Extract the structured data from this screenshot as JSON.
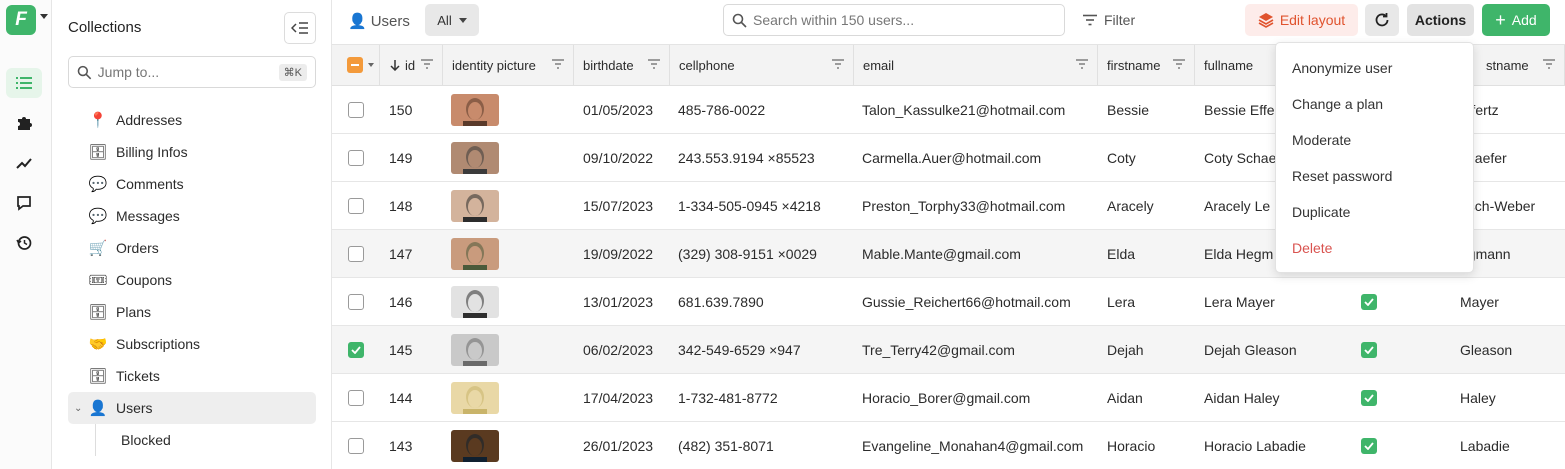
{
  "app": {
    "logo_letter": "F"
  },
  "sidebar": {
    "title": "Collections",
    "search_placeholder": "Jump to...",
    "shortcut": "⌘K",
    "items": [
      {
        "label": "Addresses",
        "emoji": "📍"
      },
      {
        "label": "Billing Infos",
        "emoji": "🗄"
      },
      {
        "label": "Comments",
        "emoji": "💬"
      },
      {
        "label": "Messages",
        "emoji": "💬"
      },
      {
        "label": "Orders",
        "emoji": "🛒"
      },
      {
        "label": "Coupons",
        "emoji": "🎟"
      },
      {
        "label": "Plans",
        "emoji": "🗄"
      },
      {
        "label": "Subscriptions",
        "emoji": "🤝"
      },
      {
        "label": "Tickets",
        "emoji": "🗄"
      },
      {
        "label": "Users",
        "emoji": "👤"
      }
    ],
    "sub_items": [
      {
        "label": "Blocked"
      }
    ]
  },
  "toolbar": {
    "collection_label": "Users",
    "collection_emoji": "👤",
    "view_label": "All",
    "search_placeholder": "Search within 150 users...",
    "filter_label": "Filter",
    "edit_layout_label": "Edit layout",
    "actions_label": "Actions",
    "add_label": "Add"
  },
  "table": {
    "columns": [
      "id",
      "identity picture",
      "birthdate",
      "cellphone",
      "email",
      "firstname",
      "fullname",
      "lastname"
    ],
    "visible_headers": {
      "id": "id",
      "identity_picture": "identity picture",
      "birthdate": "birthdate",
      "cellphone": "cellphone",
      "email": "email",
      "firstname": "firstname",
      "fullname": "fullname",
      "lastname_partial": "stname"
    },
    "rows": [
      {
        "id": "150",
        "birthdate": "01/05/2023",
        "cellphone": "485-786-0022",
        "email": "Talon_Kassulke21@hotmail.com",
        "firstname": "Bessie",
        "fullname": "Bessie Effe",
        "lastname": "effertz",
        "flag": false,
        "selected": false
      },
      {
        "id": "149",
        "birthdate": "09/10/2022",
        "cellphone": "243.553.9194 ×85523",
        "email": "Carmella.Auer@hotmail.com",
        "firstname": "Coty",
        "fullname": "Coty Schae",
        "lastname": "chaefer",
        "flag": false,
        "selected": false
      },
      {
        "id": "148",
        "birthdate": "15/07/2023",
        "cellphone": "1-334-505-0945 ×4218",
        "email": "Preston_Torphy33@hotmail.com",
        "firstname": "Aracely",
        "fullname": "Aracely Le",
        "lastname": "esch-Weber",
        "flag": false,
        "selected": false
      },
      {
        "id": "147",
        "birthdate": "19/09/2022",
        "cellphone": "(329) 308-9151 ×0029",
        "email": "Mable.Mante@gmail.com",
        "firstname": "Elda",
        "fullname": "Elda Hegm",
        "lastname": "egmann",
        "flag": false,
        "selected": false
      },
      {
        "id": "146",
        "birthdate": "13/01/2023",
        "cellphone": "681.639.7890",
        "email": "Gussie_Reichert66@hotmail.com",
        "firstname": "Lera",
        "fullname": "Lera Mayer",
        "lastname": "Mayer",
        "flag": true,
        "selected": false
      },
      {
        "id": "145",
        "birthdate": "06/02/2023",
        "cellphone": "342-549-6529 ×947",
        "email": "Tre_Terry42@gmail.com",
        "firstname": "Dejah",
        "fullname": "Dejah Gleason",
        "lastname": "Gleason",
        "flag": true,
        "selected": true
      },
      {
        "id": "144",
        "birthdate": "17/04/2023",
        "cellphone": "1-732-481-8772",
        "email": "Horacio_Borer@gmail.com",
        "firstname": "Aidan",
        "fullname": "Aidan Haley",
        "lastname": "Haley",
        "flag": true,
        "selected": false
      },
      {
        "id": "143",
        "birthdate": "26/01/2023",
        "cellphone": "(482) 351-8071",
        "email": "Evangeline_Monahan4@gmail.com",
        "firstname": "Horacio",
        "fullname": "Horacio Labadie",
        "lastname": "Labadie",
        "flag": true,
        "selected": false
      }
    ]
  },
  "actions_menu": {
    "items": [
      {
        "label": "Anonymize user"
      },
      {
        "label": "Change a plan"
      },
      {
        "label": "Moderate"
      },
      {
        "label": "Reset password"
      },
      {
        "label": "Duplicate"
      },
      {
        "label": "Delete",
        "danger": true
      }
    ]
  },
  "colors": {
    "accent": "#3fb56a",
    "warning": "#f39a3b",
    "edit_layout": "#e0532e",
    "danger": "#d9534f"
  }
}
